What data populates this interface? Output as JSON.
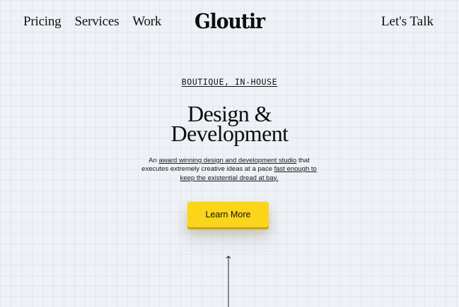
{
  "nav": {
    "links": [
      "Pricing",
      "Services",
      "Work"
    ],
    "logo": "Gloutir",
    "cta": "Let's Talk"
  },
  "hero": {
    "eyebrow": "BOUTIQUE, IN-HOUSE",
    "headline_line1": "Design &",
    "headline_line2": "Development",
    "desc_part1": "An ",
    "desc_link1": "award winning design and development studio",
    "desc_part2": " that executes extremely creative ideas at a pace ",
    "desc_link2": "fast enough to keep the existential dread at bay.",
    "button_label": "Learn More"
  },
  "colors": {
    "background": "#eef1f6",
    "button": "#fbd51a",
    "text": "#111111"
  },
  "icons": {
    "scroll_indicator": "arrow-up-icon"
  }
}
